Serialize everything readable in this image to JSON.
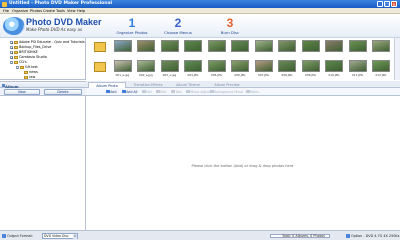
{
  "window": {
    "title": "Untitled - Photo DVD Maker Professional",
    "controls": [
      "_",
      "□",
      "×"
    ]
  },
  "menu": [
    "File",
    "Organize",
    "Photos",
    "Create",
    "Tools",
    "View",
    "Help"
  ],
  "banner": {
    "product_name": "Photo DVD Maker",
    "tagline": "Make Photo DVD As easy as",
    "steps": [
      {
        "num": "1",
        "label": "Organize Photos"
      },
      {
        "num": "2",
        "label": "Choose Menus"
      },
      {
        "num": "3",
        "label": "Burn Disc"
      }
    ]
  },
  "folder_tree": [
    {
      "label": "Adobe PSI Educate - Quiz and Tutorials",
      "expander": "+"
    },
    {
      "label": "Backup_Files_Drive",
      "expander": "+"
    },
    {
      "label": "BRITISHIKE",
      "expander": "+"
    },
    {
      "label": "Camtasia Studio",
      "expander": "+"
    },
    {
      "label": "CD's",
      "expander": "-"
    },
    {
      "label": "GH.test",
      "expander": "-"
    },
    {
      "label": "news",
      "expander": ""
    },
    {
      "label": "raw",
      "expander": ""
    }
  ],
  "thumbnails": {
    "row1": [
      {
        "caption": "",
        "kind": "folder"
      },
      {
        "caption": "",
        "color": "#8aa6c4"
      },
      {
        "caption": "",
        "color": "#9c8e6c"
      },
      {
        "caption": "",
        "color": "#6f8f58"
      },
      {
        "caption": "",
        "color": "#5d8a4e"
      },
      {
        "caption": "",
        "color": "#7c9a62"
      },
      {
        "caption": "",
        "color": "#648b55"
      },
      {
        "caption": "",
        "color": "#9fb38a"
      },
      {
        "caption": "",
        "color": "#7f9669"
      },
      {
        "caption": "",
        "color": "#5e8548"
      },
      {
        "caption": "",
        "color": "#8b7d6a"
      },
      {
        "caption": "",
        "color": "#6c9456"
      },
      {
        "caption": "",
        "color": "#9aa87e"
      }
    ],
    "row2": [
      {
        "caption": "",
        "kind": "folder"
      },
      {
        "caption": "001_e.jpg",
        "color": "#c9c2b2"
      },
      {
        "caption": "002_e.jpg",
        "color": "#a8b894"
      },
      {
        "caption": "003_e.jpg",
        "color": "#6d8a5a"
      },
      {
        "caption": "004.JPG",
        "color": "#5f8e55"
      },
      {
        "caption": "005.JPG",
        "color": "#7a9c62"
      },
      {
        "caption": "006.JPG",
        "color": "#8aa06e"
      },
      {
        "caption": "007.JPG",
        "color": "#b49c82"
      },
      {
        "caption": "008.JPG",
        "color": "#6a8a58"
      },
      {
        "caption": "009.JPG",
        "color": "#7e9b66"
      },
      {
        "caption": "010.JPG",
        "color": "#5c874c"
      },
      {
        "caption": "011.JPG",
        "color": "#a1a890"
      },
      {
        "caption": "012.JPG",
        "color": "#6e9a58"
      }
    ]
  },
  "album_panel": {
    "header": "Album",
    "new_label": "New",
    "delete_label": "Delete"
  },
  "tabs": [
    {
      "label": "Album Photo",
      "active": true
    },
    {
      "label": "Transition Effects",
      "active": false
    },
    {
      "label": "Album Theme",
      "active": false
    },
    {
      "label": "Album Preview",
      "active": false
    }
  ],
  "toolbar": [
    {
      "label": "Add",
      "enabled": true
    },
    {
      "label": "Add All",
      "enabled": true
    },
    {
      "label": "Del",
      "enabled": false
    },
    {
      "label": "Edit",
      "enabled": false
    },
    {
      "label": "Text",
      "enabled": false
    },
    {
      "label": "Music Adjust",
      "enabled": false
    },
    {
      "label": "Background Music",
      "enabled": false
    },
    {
      "label": "More...",
      "enabled": false
    }
  ],
  "photo_area": {
    "hint": "Please click the button (Add) or drag & drop photos here."
  },
  "status": {
    "output_label": "Output Format:",
    "output_value": "DVD Video Disc",
    "totals": "Total: 0 Albums, 0 Photos",
    "option": "Option - DVD 4.7G 4X 250Ks",
    "progress": 0
  }
}
